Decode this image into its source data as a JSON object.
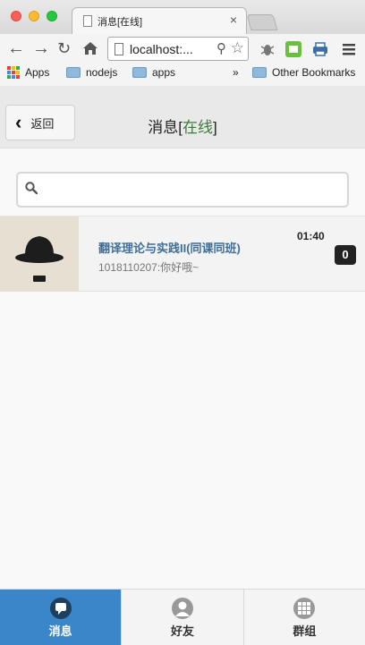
{
  "browser": {
    "tab_title": "消息[在线]",
    "tab_close": "×",
    "url": "localhost:...",
    "bookmarks": [
      "Apps",
      "nodejs",
      "apps"
    ],
    "bookmarks_overflow": "»",
    "other_bookmarks": "Other Bookmarks"
  },
  "header": {
    "back_label": "返回",
    "title_main": "消息",
    "title_status": "在线"
  },
  "search": {
    "placeholder": ""
  },
  "conversations": [
    {
      "name": "翻译理论与实践II(同课同班)",
      "last_message": "1018110207:你好哦~",
      "time": "01:40",
      "unread": "0"
    }
  ],
  "tabbar": {
    "items": [
      {
        "label": "消息",
        "icon": "chat-bubble-icon"
      },
      {
        "label": "好友",
        "icon": "person-icon"
      },
      {
        "label": "群组",
        "icon": "grid-icon"
      }
    ],
    "active": 0
  },
  "colors": {
    "accent": "#3a86c8",
    "online_status": "#3a7d3a",
    "conversation_name": "#3f6f98"
  }
}
